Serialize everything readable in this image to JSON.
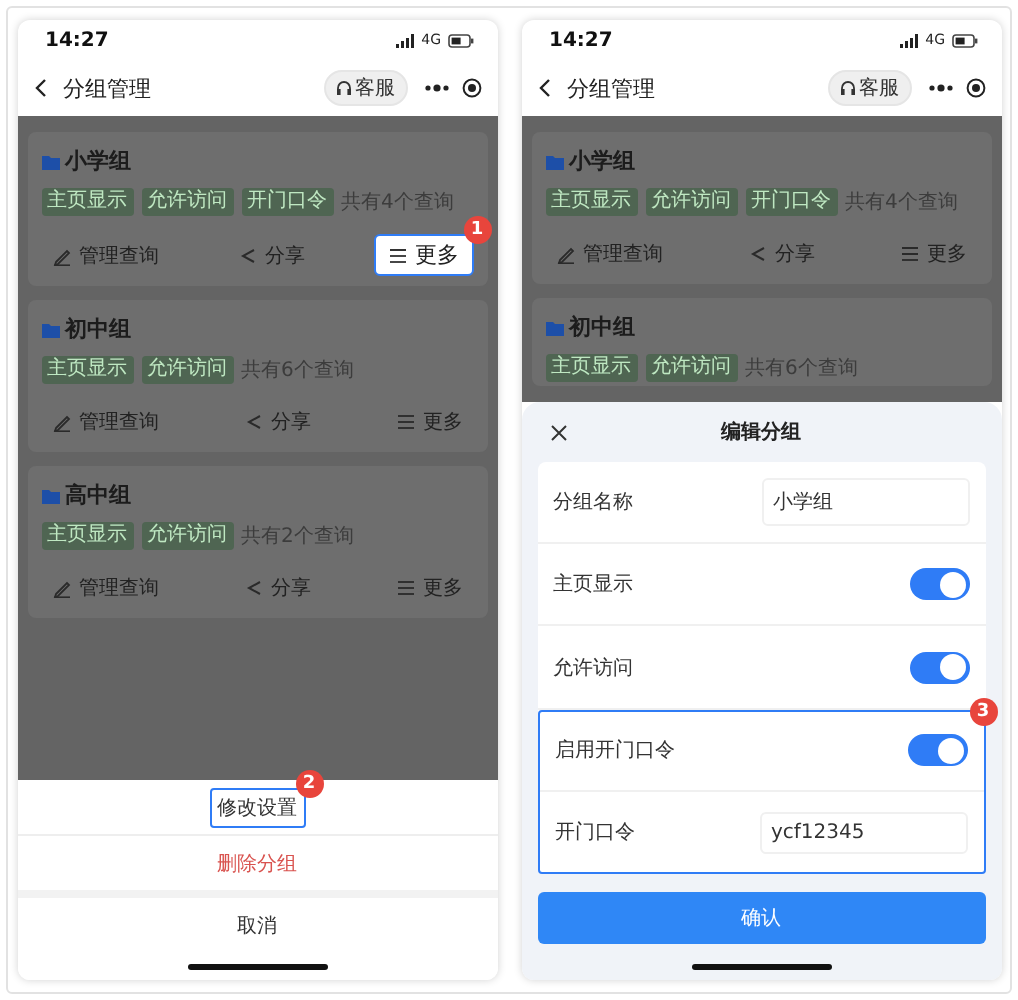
{
  "screens": [
    {
      "status_bar": {
        "time": "14:27",
        "network": "4G"
      },
      "nav": {
        "title": "分组管理",
        "service_label": "客服"
      },
      "groups": [
        {
          "name": "小学组",
          "tags": [
            "主页显示",
            "允许访问",
            "开门口令"
          ],
          "count": "共有4个查询",
          "actions": [
            {
              "kind": "manage",
              "label": "管理查询",
              "highlighted": false
            },
            {
              "kind": "share",
              "label": "分享",
              "highlighted": false
            },
            {
              "kind": "more",
              "label": "更多",
              "highlighted": true,
              "badge": "1"
            }
          ]
        },
        {
          "name": "初中组",
          "tags": [
            "主页显示",
            "允许访问"
          ],
          "count": "共有6个查询",
          "actions": [
            {
              "kind": "manage",
              "label": "管理查询",
              "highlighted": false
            },
            {
              "kind": "share",
              "label": "分享",
              "highlighted": false
            },
            {
              "kind": "more",
              "label": "更多",
              "highlighted": false
            }
          ]
        },
        {
          "name": "高中组",
          "tags": [
            "主页显示",
            "允许访问"
          ],
          "count": "共有2个查询",
          "actions": [
            {
              "kind": "manage",
              "label": "管理查询",
              "highlighted": false
            },
            {
              "kind": "share",
              "label": "分享",
              "highlighted": false
            },
            {
              "kind": "more",
              "label": "更多",
              "highlighted": false
            }
          ]
        }
      ],
      "sheet": {
        "kind": "action_sheet",
        "items": [
          {
            "kind": "normal",
            "label": "修改设置",
            "highlighted": true,
            "badge": "2"
          },
          {
            "kind": "danger",
            "label": "删除分组",
            "highlighted": false
          },
          {
            "kind": "cancel",
            "label": "取消",
            "highlighted": false
          }
        ]
      }
    },
    {
      "status_bar": {
        "time": "14:27",
        "network": "4G"
      },
      "nav": {
        "title": "分组管理",
        "service_label": "客服"
      },
      "groups": [
        {
          "name": "小学组",
          "tags": [
            "主页显示",
            "允许访问",
            "开门口令"
          ],
          "count": "共有4个查询",
          "actions": [
            {
              "kind": "manage",
              "label": "管理查询",
              "highlighted": false
            },
            {
              "kind": "share",
              "label": "分享",
              "highlighted": false
            },
            {
              "kind": "more",
              "label": "更多",
              "highlighted": false
            }
          ]
        },
        {
          "name": "初中组",
          "tags": [
            "主页显示",
            "允许访问"
          ],
          "count": "共有6个查询"
        }
      ],
      "sheet": {
        "kind": "edit_form",
        "title": "编辑分组",
        "confirm": "确认",
        "fields": [
          {
            "kind": "text",
            "label": "分组名称",
            "value": "小学组",
            "highlighted": false
          },
          {
            "kind": "switch",
            "label": "主页显示",
            "on": true,
            "highlighted": false
          },
          {
            "kind": "switch",
            "label": "允许访问",
            "on": true,
            "highlighted": false
          },
          {
            "kind": "switch",
            "label": "启用开门口令",
            "on": true,
            "highlighted": true,
            "badge": "3"
          },
          {
            "kind": "text",
            "label": "开门口令",
            "value": "ycf12345",
            "highlighted": true
          }
        ]
      }
    }
  ]
}
